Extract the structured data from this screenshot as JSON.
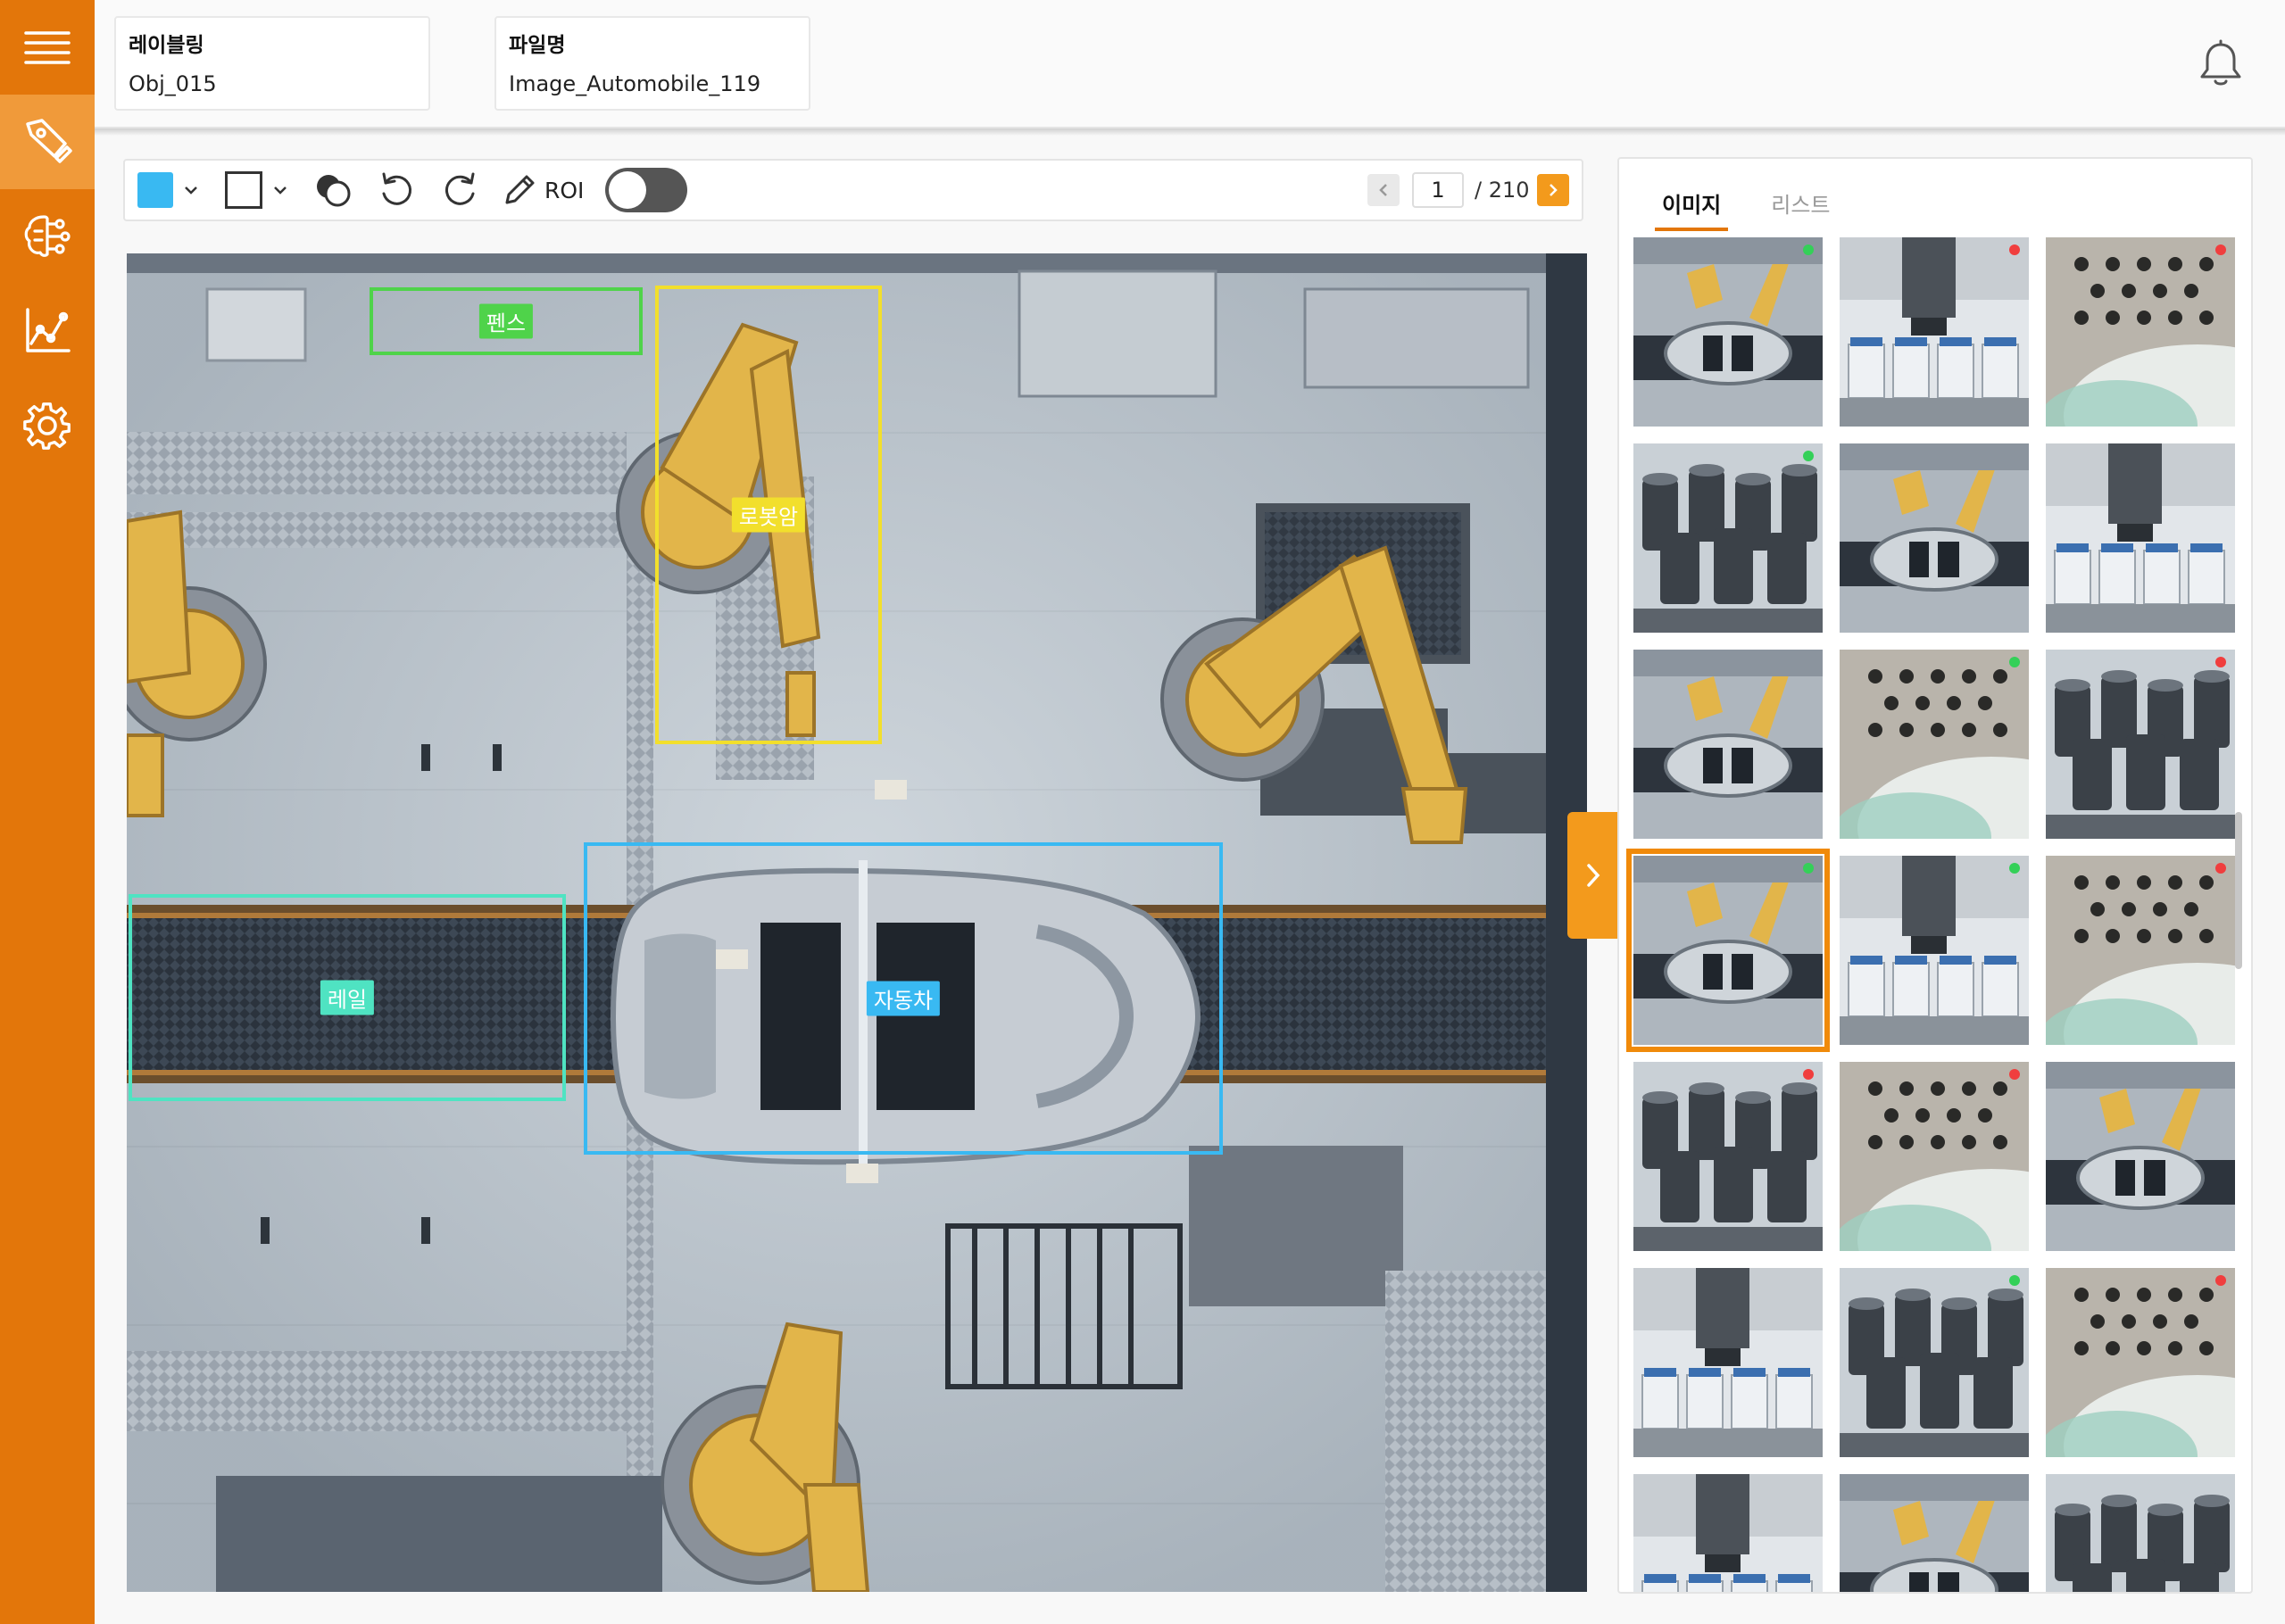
{
  "header": {
    "labeling_label": "레이블링",
    "labeling_value": "Obj_015",
    "filename_label": "파일명",
    "filename_value": "Image_Automobile_119"
  },
  "sidebar": {
    "items": [
      {
        "name": "menu-icon",
        "active": false
      },
      {
        "name": "labeling-pen-icon",
        "active": true
      },
      {
        "name": "ai-brain-icon",
        "active": false
      },
      {
        "name": "analytics-chart-icon",
        "active": false
      },
      {
        "name": "settings-gear-icon",
        "active": false
      }
    ]
  },
  "toolbar": {
    "color": "#39b9f2",
    "roi_label": "ROI",
    "roi_enabled": false,
    "page_current": "1",
    "page_total": "/ 210"
  },
  "annotations": [
    {
      "label": "펜스",
      "color": "#4fd34a"
    },
    {
      "label": "로봇암",
      "color": "#f2df2c"
    },
    {
      "label": "레일",
      "color": "#4fe3c2"
    },
    {
      "label": "자동차",
      "color": "#39b9f2"
    }
  ],
  "panel": {
    "tabs": [
      {
        "label": "이미지",
        "active": true
      },
      {
        "label": "리스트",
        "active": false
      }
    ],
    "thumbnails": [
      {
        "scene": "robot",
        "status": "#34d058",
        "selected": false
      },
      {
        "scene": "vials",
        "status": "#f03e3e",
        "selected": false
      },
      {
        "scene": "perforated",
        "status": "#f03e3e",
        "selected": false
      },
      {
        "scene": "cans",
        "status": "#34d058",
        "selected": false
      },
      {
        "scene": "robot",
        "status": "",
        "selected": false
      },
      {
        "scene": "vials",
        "status": "",
        "selected": false
      },
      {
        "scene": "robot",
        "status": "",
        "selected": false
      },
      {
        "scene": "perforated",
        "status": "#34d058",
        "selected": false
      },
      {
        "scene": "cans",
        "status": "#f03e3e",
        "selected": false
      },
      {
        "scene": "robot",
        "status": "#34d058",
        "selected": true
      },
      {
        "scene": "vials",
        "status": "#34d058",
        "selected": false
      },
      {
        "scene": "perforated",
        "status": "#f03e3e",
        "selected": false
      },
      {
        "scene": "cans",
        "status": "#f03e3e",
        "selected": false
      },
      {
        "scene": "perforated",
        "status": "#f03e3e",
        "selected": false
      },
      {
        "scene": "robot",
        "status": "",
        "selected": false
      },
      {
        "scene": "vials",
        "status": "",
        "selected": false
      },
      {
        "scene": "cans",
        "status": "#34d058",
        "selected": false
      },
      {
        "scene": "perforated",
        "status": "#f03e3e",
        "selected": false
      },
      {
        "scene": "vials",
        "status": "",
        "selected": false
      },
      {
        "scene": "robot",
        "status": "",
        "selected": false
      },
      {
        "scene": "cans",
        "status": "",
        "selected": false
      }
    ]
  },
  "colors": {
    "accent": "#e3760a",
    "accent_light": "#f39a1c"
  }
}
